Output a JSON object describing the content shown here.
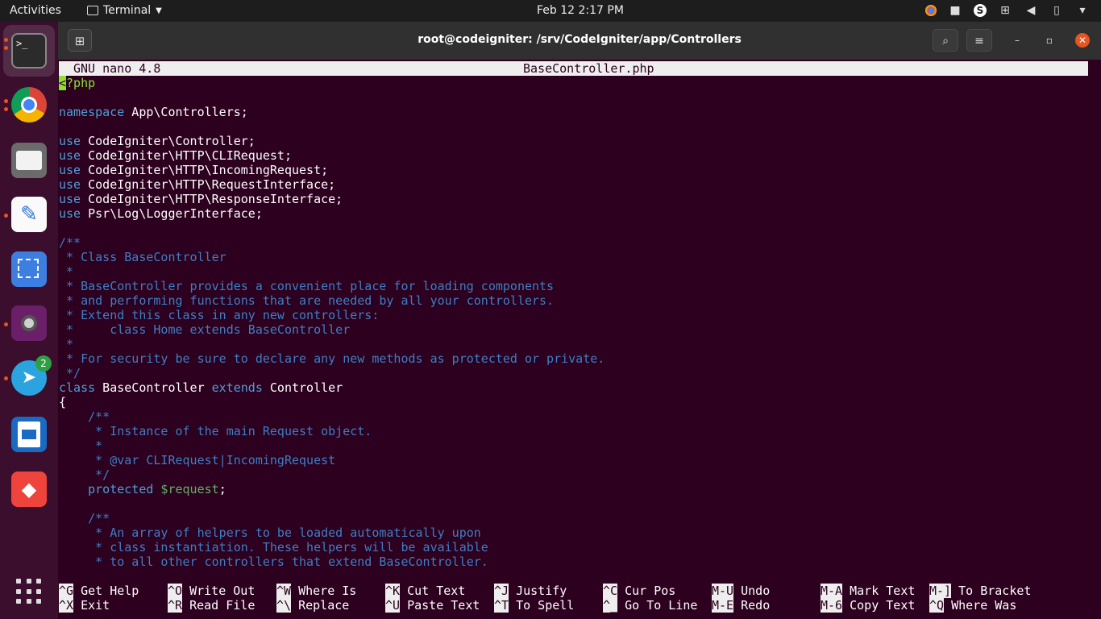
{
  "topbar": {
    "activities": "Activities",
    "app_name": "Terminal",
    "clock": "Feb 12  2:17 PM"
  },
  "dock": {
    "apps": [
      "terminal",
      "chrome",
      "files",
      "text-editor",
      "screenshot",
      "video-recorder",
      "telegram",
      "writer",
      "anydesk"
    ],
    "telegram_badge": "2"
  },
  "window": {
    "title": "root@codeigniter: /srv/CodeIgniter/app/Controllers"
  },
  "nano": {
    "version": "GNU nano 4.8",
    "filename": "BaseController.php"
  },
  "code_lines": [
    {
      "text": "<?php"
    },
    {
      "text": ""
    },
    {
      "kw": "namespace",
      "text": " App\\Controllers;"
    },
    {
      "text": ""
    },
    {
      "kw": "use",
      "text": " CodeIgniter\\Controller;"
    },
    {
      "kw": "use",
      "text": " CodeIgniter\\HTTP\\CLIRequest;"
    },
    {
      "kw": "use",
      "text": " CodeIgniter\\HTTP\\IncomingRequest;"
    },
    {
      "kw": "use",
      "text": " CodeIgniter\\HTTP\\RequestInterface;"
    },
    {
      "kw": "use",
      "text": " CodeIgniter\\HTTP\\ResponseInterface;"
    },
    {
      "kw": "use",
      "text": " Psr\\Log\\LoggerInterface;"
    },
    {
      "text": ""
    },
    {
      "cm": "/**"
    },
    {
      "cm": " * Class BaseController"
    },
    {
      "cm": " *"
    },
    {
      "cm": " * BaseController provides a convenient place for loading components"
    },
    {
      "cm": " * and performing functions that are needed by all your controllers."
    },
    {
      "cm": " * Extend this class in any new controllers:"
    },
    {
      "cm": " *     class Home extends BaseController"
    },
    {
      "cm": " *"
    },
    {
      "cm": " * For security be sure to declare any new methods as protected or private."
    },
    {
      "cm": " */"
    },
    {
      "kw": "class",
      "text": " BaseController ",
      "kw2": "extends",
      "text2": " Controller"
    },
    {
      "text": "{"
    },
    {
      "cm": "    /**"
    },
    {
      "cm": "     * Instance of the main Request object."
    },
    {
      "cm": "     *"
    },
    {
      "cm": "     * @var CLIRequest|IncomingRequest"
    },
    {
      "cm": "     */"
    },
    {
      "kw": "    protected",
      "var": " $request",
      "text": ";"
    },
    {
      "text": ""
    },
    {
      "cm": "    /**"
    },
    {
      "cm": "     * An array of helpers to be loaded automatically upon"
    },
    {
      "cm": "     * class instantiation. These helpers will be available"
    },
    {
      "cm": "     * to all other controllers that extend BaseController."
    }
  ],
  "shortcuts": [
    {
      "key": "^G",
      "label": "Get Help"
    },
    {
      "key": "^X",
      "label": "Exit"
    },
    {
      "key": "^O",
      "label": "Write Out"
    },
    {
      "key": "^R",
      "label": "Read File"
    },
    {
      "key": "^W",
      "label": "Where Is"
    },
    {
      "key": "^\\",
      "label": "Replace"
    },
    {
      "key": "^K",
      "label": "Cut Text"
    },
    {
      "key": "^U",
      "label": "Paste Text"
    },
    {
      "key": "^J",
      "label": "Justify"
    },
    {
      "key": "^T",
      "label": "To Spell"
    },
    {
      "key": "^C",
      "label": "Cur Pos"
    },
    {
      "key": "^_",
      "label": "Go To Line"
    },
    {
      "key": "M-U",
      "label": "Undo"
    },
    {
      "key": "M-E",
      "label": "Redo"
    },
    {
      "key": "M-A",
      "label": "Mark Text"
    },
    {
      "key": "M-6",
      "label": "Copy Text"
    },
    {
      "key": "M-]",
      "label": "To Bracket"
    },
    {
      "key": "^Q",
      "label": "Where Was"
    }
  ]
}
